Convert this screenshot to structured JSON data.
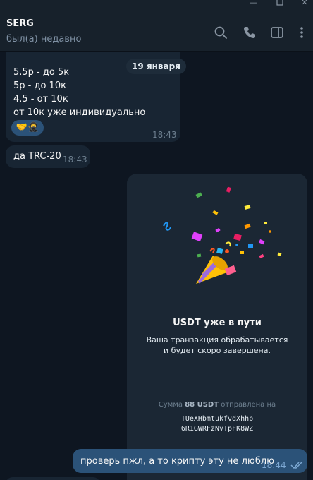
{
  "header": {
    "name": "SERG",
    "status": "был(а) недавно"
  },
  "date_separator": "19 января",
  "messages": [
    {
      "text": "5.5р - до 5к\n5р - до 10к\n4.5 - от 10к\nот 10к уже индивидуально",
      "time": "18:43",
      "stickers": "🤝🥷"
    },
    {
      "text": "да TRC-20",
      "time": "18:43"
    }
  ],
  "transfer_card": {
    "title": "USDT уже в пути",
    "subtitle": "Ваша транзакция обрабатывается\nи будет скоро завершена.",
    "amount_prefix": "Сумма",
    "amount": "88 USDT",
    "amount_suffix": "отправлена на",
    "address": "TUeXHbmtukfvdXhhb\n6R1GWRFzNvTpFK8WZ"
  },
  "outgoing": {
    "text": "проверь пжл, а то крипту эту не люблю",
    "time": "18:44"
  },
  "icons": [
    "minimize-icon",
    "maximize-icon",
    "search-icon",
    "phone-icon",
    "sidebar-toggle-icon",
    "more-vertical-icon",
    "read-checkmarks-icon",
    "party-popper-icon"
  ]
}
